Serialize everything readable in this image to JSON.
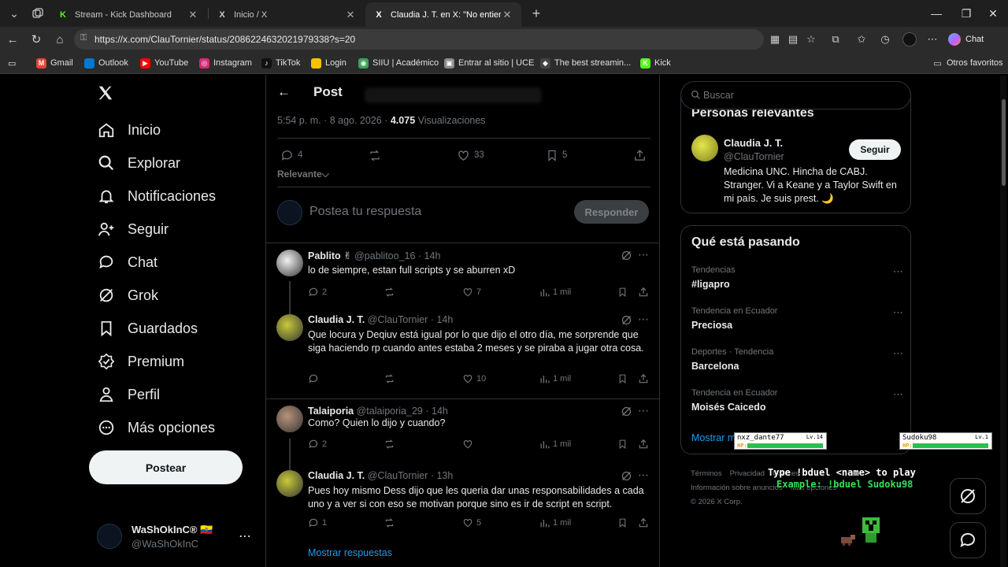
{
  "browser": {
    "tabs": [
      {
        "title": "Stream - Kick Dashboard",
        "favicon": "K",
        "color": "#53fc18"
      },
      {
        "title": "Inicio / X",
        "favicon": "X",
        "color": "#ffffff"
      },
      {
        "title": "Claudia J. T. en X: \"No entiendo, no",
        "favicon": "X",
        "color": "#ffffff"
      }
    ],
    "url": "https://x.com/ClauTornier/status/2086224632021979338?s=20",
    "chat_label": "Chat",
    "bookmarks": [
      {
        "label": "Gmail",
        "icon": "M",
        "color": "#ea4335"
      },
      {
        "label": "Outlook",
        "icon": "",
        "color": "#0078d4"
      },
      {
        "label": "YouTube",
        "icon": "▶",
        "color": "#ff0000"
      },
      {
        "label": "Instagram",
        "icon": "◎",
        "color": "#d62976"
      },
      {
        "label": "TikTok",
        "icon": "♪",
        "color": "#111111"
      },
      {
        "label": "Login",
        "icon": "",
        "color": "#f5c400"
      },
      {
        "label": "SIIU | Académico",
        "icon": "◉",
        "color": "#3aa35a"
      },
      {
        "label": "Entrar al sitio | UCE",
        "icon": "▣",
        "color": "#8a8a8a"
      },
      {
        "label": "The best streamin...",
        "icon": "◆",
        "color": "#444444"
      },
      {
        "label": "Kick",
        "icon": "K",
        "color": "#53fc18"
      }
    ],
    "other_favorites": "Otros favoritos"
  },
  "nav": {
    "items": [
      {
        "label": "Inicio",
        "icon": "home-icon"
      },
      {
        "label": "Explorar",
        "icon": "search-icon"
      },
      {
        "label": "Notificaciones",
        "icon": "bell-icon"
      },
      {
        "label": "Seguir",
        "icon": "follow-icon"
      },
      {
        "label": "Chat",
        "icon": "chat-icon"
      },
      {
        "label": "Grok",
        "icon": "grok-icon"
      },
      {
        "label": "Guardados",
        "icon": "bookmark-icon"
      },
      {
        "label": "Premium",
        "icon": "premium-icon"
      },
      {
        "label": "Perfil",
        "icon": "profile-icon"
      },
      {
        "label": "Más opciones",
        "icon": "more-icon"
      }
    ],
    "post_button": "Postear",
    "account": {
      "name": "WaShOkInC® 🇪🇨",
      "handle": "@WaShOkInC"
    }
  },
  "post": {
    "header_title": "Post",
    "time": "5:54 p. m. · 8 ago. 2026 ·",
    "views_count": "4.075",
    "views_label": "Visualizaciones",
    "replies": "4",
    "reposts": "",
    "likes": "33",
    "bookmarks": "5",
    "sort_label": "Relevante",
    "reply_placeholder": "Postea tu respuesta",
    "reply_button": "Responder"
  },
  "replies": [
    {
      "name": "Pablito ✌",
      "handle": "@pablitoo_16 · 14h",
      "text": "lo de siempre, estan full scripts y se aburren xD",
      "replies": "2",
      "likes": "7",
      "views": "1 mil",
      "avatar_color": "#f2f2f2"
    },
    {
      "name": "Claudia J. T.",
      "handle": "@ClauTornier · 14h",
      "text": "Que locura y Deqiuv está igual por lo que dijo el otro día, me sorprende que siga haciendo rp cuando antes estaba 2 meses y se piraba a jugar otra cosa.",
      "replies": "",
      "likes": "10",
      "views": "1 mil",
      "avatar_color": "#c9c93a"
    },
    {
      "name": "Talaiporia",
      "handle": "@talaiporia_29 · 14h",
      "text": "Como? Quien lo dijo y cuando?",
      "replies": "2",
      "likes": "",
      "views": "1 mil",
      "avatar_color": "#b8937a"
    },
    {
      "name": "Claudia J. T.",
      "handle": "@ClauTornier · 13h",
      "text": "Pues hoy mismo Dess dijo que les queria dar unas responsabilidades a cada uno y a ver si con eso se motivan porque sino es ir de script en script.",
      "replies": "1",
      "likes": "5",
      "views": "1 mil",
      "avatar_color": "#c9c93a"
    }
  ],
  "show_replies": "Mostrar respuestas",
  "right": {
    "search_placeholder": "Buscar",
    "relevant_title": "Personas relevantes",
    "relevant": {
      "name": "Claudia J. T.",
      "handle": "@ClauTornier",
      "bio": "Medicina UNC. Hincha de CABJ. Stranger. Vi a Keane y a Taylor Swift en mi país. Je suis prest. 🌙",
      "follow": "Seguir"
    },
    "trending_title": "Qué está pasando",
    "trends": [
      {
        "context": "Tendencias",
        "topic": "#ligapro"
      },
      {
        "context": "Tendencia en Ecuador",
        "topic": "Preciosa"
      },
      {
        "context": "Deportes · Tendencia",
        "topic": "Barcelona"
      },
      {
        "context": "Tendencia en Ecuador",
        "topic": "Moisés Caicedo"
      }
    ],
    "show_more": "Mostrar más",
    "footer": [
      "Términos",
      "Privacidad",
      "Cookies",
      "Información sobre anuncios",
      "Más opciones",
      "© 2026 X Corp."
    ]
  },
  "overlay": {
    "player1": {
      "name": "nxz_dante77",
      "level": "Lv.14",
      "hp_label": "HP:",
      "hp": 1.0
    },
    "player2": {
      "name": "Sudoku98",
      "level": "Lv.1",
      "hp_label": "HP:",
      "hp": 1.0
    },
    "cmd_line1": "Type !bduel <name> to play",
    "cmd_line2": "Example: !bduel Sudoku98"
  }
}
